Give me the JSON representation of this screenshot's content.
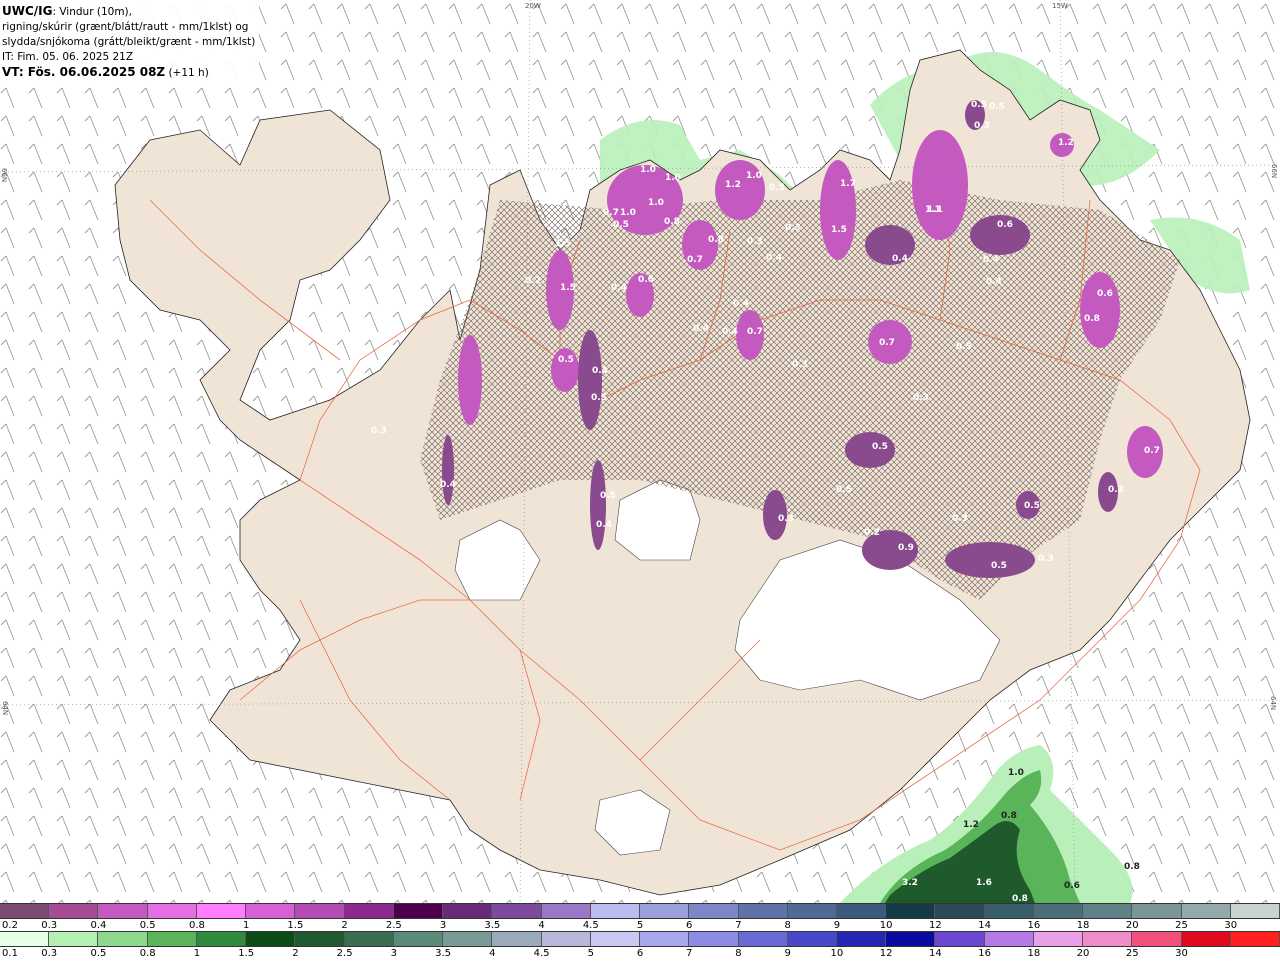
{
  "header": {
    "title_bold": "UWC/IG",
    "title_rest": ": Vindur (10m),",
    "line2": "rigning/skúrir (grænt/blátt/rautt - mm/1klst) og",
    "line3": "slydda/snjókoma (grátt/bleikt/grænt - mm/1klst)",
    "line4": "IT: Fim. 05. 06. 2025 21Z",
    "line5_bold": "VT: Fös. 06.06.2025 08Z",
    "line5_rest": " (+11 h)"
  },
  "map": {
    "coord_labels": [
      "20W",
      "15W",
      "66N",
      "66N",
      "64N",
      "64N"
    ],
    "colors": {
      "land": "#f0e4d7",
      "roads": "#e8623a",
      "glacier": "#ffffff",
      "snow_purple": "#b24fcf",
      "snow_dark": "#6e3a7a",
      "rain_light": "#b9f0b9",
      "rain_dark": "#1f6b2e"
    },
    "precip_labels": [
      "1.0",
      "1.0",
      "1.0",
      "0.7",
      "1.0",
      "0.8",
      "1.2",
      "1.0",
      "0.5",
      "1.7",
      "1.5",
      "0.3",
      "1.1",
      "0.6",
      "0.4",
      "0.4",
      "0.4",
      "1.5",
      "1.5",
      "0.6",
      "0.7",
      "0.8",
      "0.7",
      "0.5",
      "0.4",
      "0.5",
      "0.7",
      "0.5",
      "0.4",
      "0.3",
      "0.5",
      "0.3",
      "0.7",
      "0.3",
      "0.5",
      "0.5",
      "0.3",
      "0.2",
      "0.9",
      "0.3",
      "0.5",
      "0.3",
      "0.4",
      "0.4",
      "1.2",
      "0.5",
      "0.5",
      "0.3",
      "1.1",
      "0.8",
      "0.6",
      "0.2",
      "0.4",
      "0.5",
      "0.3",
      "0.4",
      "0.4",
      "0.5",
      "0.4",
      "0.3"
    ],
    "rain_labels": [
      "1.0",
      "0.8",
      "1.2",
      "3.2",
      "1.6",
      "0.8",
      "0.6",
      "0.8"
    ]
  },
  "scale_snow": {
    "ticks": [
      "0.2",
      "0.3",
      "0.4",
      "0.5",
      "0.8",
      "1",
      "1.5",
      "2",
      "2.5",
      "3",
      "3.5",
      "4",
      "4.5",
      "5",
      "6",
      "7",
      "8",
      "9",
      "10",
      "12",
      "14",
      "16",
      "18",
      "20",
      "25",
      "30"
    ],
    "colors": [
      "#7d4a73",
      "#a64c94",
      "#c45ac0",
      "#e36ee6",
      "#ff7dff",
      "#d661d6",
      "#b54bb5",
      "#8e2a8e",
      "#4d004d",
      "#6a2a7a",
      "#7e4a9e",
      "#9a78c8",
      "#bcbcf2",
      "#9aa0dc",
      "#7e86c8",
      "#5f72aa",
      "#4f6a96",
      "#3a5a80",
      "#143c48",
      "#2d4a5a",
      "#385e6a",
      "#4a6f7a",
      "#5f8288",
      "#7a9696",
      "#93aaa8",
      "#c8d4d2"
    ]
  },
  "scale_rain": {
    "ticks": [
      "0.1",
      "0.3",
      "0.5",
      "0.8",
      "1",
      "1.5",
      "2",
      "2.5",
      "3",
      "3.5",
      "4",
      "4.5",
      "5",
      "6",
      "7",
      "8",
      "9",
      "10",
      "12",
      "14",
      "16",
      "18",
      "20",
      "25",
      "30"
    ],
    "colors": [
      "#e6ffe6",
      "#b4f0b4",
      "#8cd88c",
      "#5ab45a",
      "#2e8b3c",
      "#0d4d15",
      "#1f5a32",
      "#3a6e50",
      "#5a8a78",
      "#7a9a98",
      "#9aaab8",
      "#b8b8dc",
      "#c8c8f2",
      "#a8a8ec",
      "#8c8ce6",
      "#6a6ad6",
      "#4848c8",
      "#2626b4",
      "#0a0aa0",
      "#6c48d0",
      "#b47ae8",
      "#e8a0e8",
      "#f08cc8",
      "#f0507a",
      "#e00a1e",
      "#ff2020"
    ]
  }
}
